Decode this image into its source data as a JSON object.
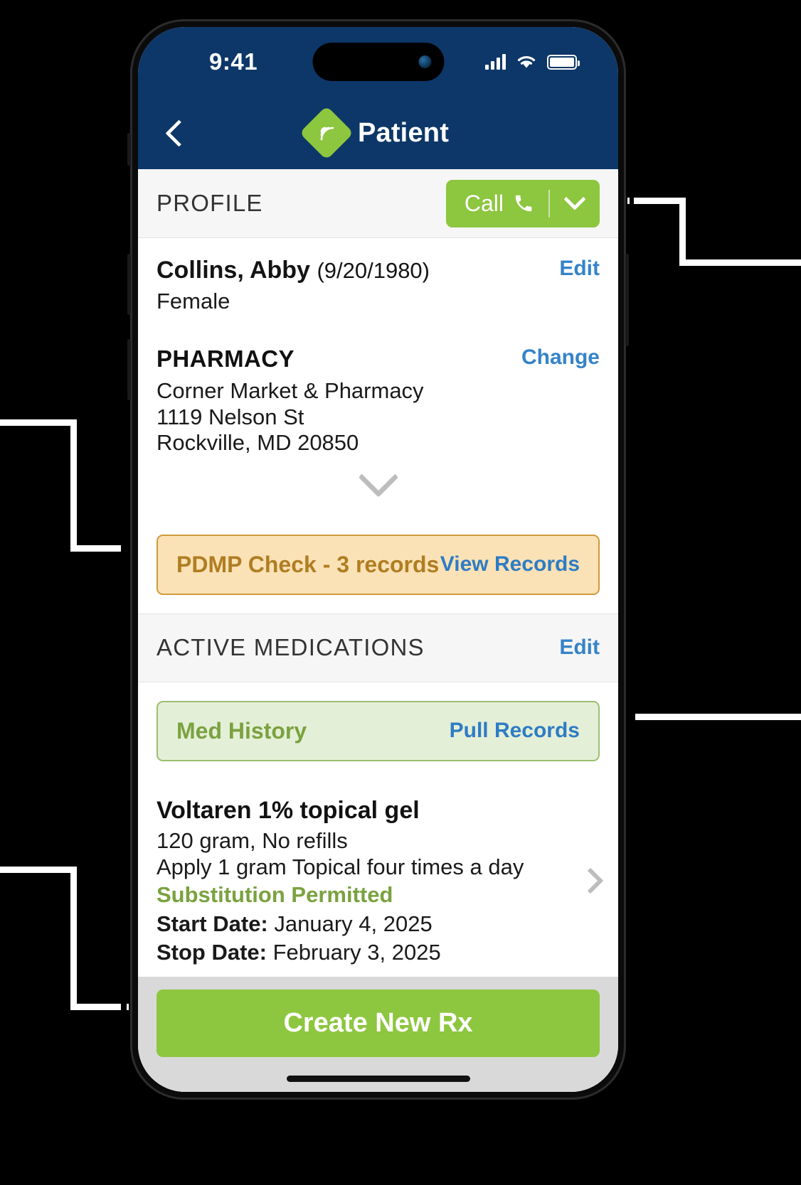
{
  "status_bar": {
    "time": "9:41",
    "cellular_icon": "signal-bars-icon",
    "wifi_icon": "wifi-icon",
    "battery_icon": "battery-full-icon"
  },
  "nav": {
    "back_icon": "chevron-left-icon",
    "logo_icon": "brand-diamond-logo-icon",
    "title": "Patient"
  },
  "profile_section": {
    "heading": "PROFILE",
    "call_button": {
      "label": "Call",
      "phone_icon": "phone-handset-icon",
      "caret_icon": "chevron-down-icon"
    },
    "patient": {
      "name": "Collins, Abby",
      "dob": "(9/20/1980)",
      "gender": "Female",
      "edit_label": "Edit"
    },
    "pharmacy": {
      "heading": "PHARMACY",
      "change_label": "Change",
      "name": "Corner Market & Pharmacy",
      "street": "1119 Nelson St",
      "city_state_zip": "Rockville, MD 20850"
    },
    "expand_icon": "chevron-down-icon"
  },
  "pdmp_banner": {
    "label": "PDMP Check - 3 records",
    "action_label": "View Records"
  },
  "medications_section": {
    "heading": "ACTIVE MEDICATIONS",
    "edit_label": "Edit",
    "med_history_banner": {
      "label": "Med History",
      "action_label": "Pull Records"
    },
    "medication": {
      "name": "Voltaren 1% topical gel",
      "quantity_refills": "120 gram, No refills",
      "sig": "Apply 1 gram Topical four times a day",
      "substitution": "Substitution Permitted",
      "start_date_label": "Start Date:",
      "start_date_value": "January 4, 2025",
      "stop_date_label": "Stop Date:",
      "stop_date_value": "February 3, 2025",
      "disclosure_icon": "chevron-right-icon"
    }
  },
  "bottom_bar": {
    "cta_label": "Create New Rx",
    "home_indicator": "home-indicator"
  },
  "colors": {
    "brand_green": "#8dc63f",
    "header_navy": "#0d3768",
    "link_blue": "#3583c9",
    "pdmp_amber_bg": "#fbe2b6",
    "pdmp_amber_border": "#cf9a3a",
    "pdmp_amber_text": "#b07d22",
    "med_green_bg": "#e4efd7",
    "med_green_border": "#9cbf6e",
    "med_green_text": "#7aa23f"
  }
}
